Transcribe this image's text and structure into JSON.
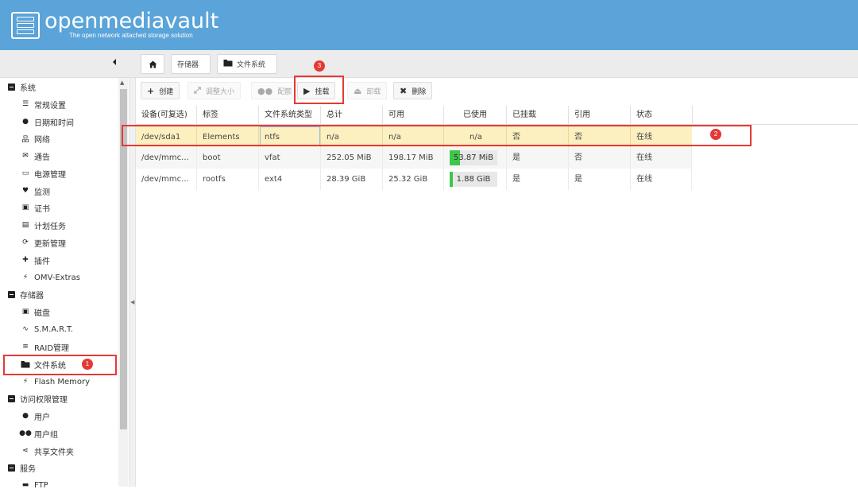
{
  "header": {
    "brand": "openmediavault",
    "tagline": "The open network attached storage solution"
  },
  "breadcrumb": {
    "storage": "存储器",
    "filesystems": "文件系统"
  },
  "sidebar": {
    "groups": [
      {
        "label": "系统",
        "items": [
          {
            "label": "常规设置",
            "icon": "sliders-icon"
          },
          {
            "label": "日期和时间",
            "icon": "clock-icon"
          },
          {
            "label": "网络",
            "icon": "network-icon"
          },
          {
            "label": "通告",
            "icon": "envelope-icon"
          },
          {
            "label": "电源管理",
            "icon": "battery-icon"
          },
          {
            "label": "监测",
            "icon": "heartbeat-icon"
          },
          {
            "label": "证书",
            "icon": "certificate-icon"
          },
          {
            "label": "计划任务",
            "icon": "calendar-clock-icon"
          },
          {
            "label": "更新管理",
            "icon": "refresh-icon"
          },
          {
            "label": "插件",
            "icon": "puzzle-icon"
          },
          {
            "label": "OMV-Extras",
            "icon": "plug-icon"
          }
        ]
      },
      {
        "label": "存储器",
        "items": [
          {
            "label": "磁盘",
            "icon": "disk-icon"
          },
          {
            "label": "S.M.A.R.T.",
            "icon": "pulse-icon"
          },
          {
            "label": "RAID管理",
            "icon": "database-icon"
          },
          {
            "label": "文件系统",
            "icon": "folder-icon"
          },
          {
            "label": "Flash Memory",
            "icon": "bolt-icon"
          }
        ]
      },
      {
        "label": "访问权限管理",
        "items": [
          {
            "label": "用户",
            "icon": "user-icon"
          },
          {
            "label": "用户组",
            "icon": "users-icon"
          },
          {
            "label": "共享文件夹",
            "icon": "share-icon"
          }
        ]
      },
      {
        "label": "服务",
        "items": [
          {
            "label": "FTP",
            "icon": "ftp-icon"
          }
        ]
      }
    ]
  },
  "toolbar": {
    "create": "创建",
    "resize": "调整大小",
    "quota": "配额",
    "mount": "挂载",
    "unmount": "卸载",
    "delete": "删除"
  },
  "table": {
    "columns": [
      "设备(可复选)",
      "标签",
      "文件系统类型",
      "总计",
      "可用",
      "已使用",
      "已挂载",
      "引用",
      "状态"
    ],
    "rows": [
      {
        "device": "/dev/sda1",
        "label": "Elements",
        "type": "ntfs",
        "total": "n/a",
        "available": "n/a",
        "used": "n/a",
        "used_fraction": 0,
        "mounted": "否",
        "referenced": "否",
        "status": "在线"
      },
      {
        "device": "/dev/mmc...",
        "label": "boot",
        "type": "vfat",
        "total": "252.05 MiB",
        "available": "198.17 MiB",
        "used": "53.87 MiB",
        "used_fraction": 0.21,
        "mounted": "是",
        "referenced": "否",
        "status": "在线"
      },
      {
        "device": "/dev/mmc...",
        "label": "rootfs",
        "type": "ext4",
        "total": "28.39 GiB",
        "available": "25.32 GiB",
        "used": "1.88 GiB",
        "used_fraction": 0.07,
        "mounted": "是",
        "referenced": "是",
        "status": "在线"
      }
    ]
  },
  "annotations": {
    "badge1": "1",
    "badge2": "2",
    "badge3": "3"
  },
  "colors": {
    "header": "#5aa4d9",
    "selected_row": "#fdf0c0",
    "annotation": "#e53935",
    "usage_fill": "#3fc64a"
  }
}
